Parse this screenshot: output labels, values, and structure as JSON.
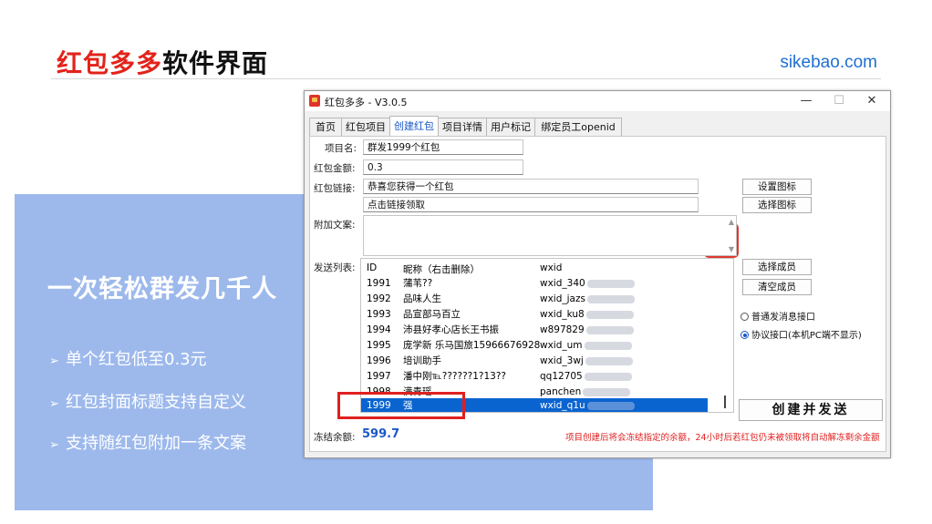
{
  "slide": {
    "title_red": "红包多多",
    "title_black": "软件界面",
    "brand": "sikebao.com",
    "heading": "一次轻松群发几千人",
    "bullets": [
      "单个红包低至0.3元",
      "红包封面标题支持自定义",
      "支持随红包附加一条文案"
    ],
    "bullet_icon": "arrow-right-icon"
  },
  "window": {
    "title": "红包多多 - V3.0.5",
    "minimize": "—",
    "maximize": "☐",
    "close": "✕",
    "tabs": [
      "首页",
      "红包项目",
      "创建红包",
      "项目详情",
      "用户标记",
      "绑定员工openid"
    ],
    "active_tab": "创建红包"
  },
  "form": {
    "project_name_label": "项目名:",
    "project_name_value": "群发1999个红包",
    "amount_label": "红包金额:",
    "amount_value": "0.3",
    "link_label": "红包链接:",
    "link_title_value": "恭喜您获得一个红包",
    "link_subtitle_value": "点击链接领取",
    "set_icon_button": "设置图标",
    "choose_icon_button": "选择图标",
    "extra_text_label": "附加文案:",
    "send_list_label": "发送列表:",
    "frozen_label": "冻结余额:",
    "frozen_value": "599.7",
    "notice": "项目创建后将会冻结指定的余额，24小时后若红包仍未被领取将自动解冻剩余金额"
  },
  "list": {
    "headers": [
      "ID",
      "昵称（右击删除）",
      "wxid"
    ],
    "rows": [
      {
        "id": "1991",
        "nick": "蒲苇??",
        "wxid": "wxid_340"
      },
      {
        "id": "1992",
        "nick": "品味人生",
        "wxid": "wxid_jazs"
      },
      {
        "id": "1993",
        "nick": "品宣部马百立",
        "wxid": "wxid_ku8"
      },
      {
        "id": "1994",
        "nick": "沛县好孝心店长王书振",
        "wxid": "w897829"
      },
      {
        "id": "1995",
        "nick": "庞学新  乐马国旅15966676928",
        "wxid": "wxid_um"
      },
      {
        "id": "1996",
        "nick": "培训助手",
        "wxid": "wxid_3wj"
      },
      {
        "id": "1997",
        "nick": "潘中刚℡??????1?13??",
        "wxid": "qq12705"
      },
      {
        "id": "1998",
        "nick": "满青瑶",
        "wxid": "panchen"
      },
      {
        "id": "1999",
        "nick": "强",
        "wxid": "wxid_q1u",
        "selected": true
      }
    ]
  },
  "side": {
    "select_members_button": "选择成员",
    "clear_members_button": "清空成员",
    "radio_normal": "普通发消息接口",
    "radio_protocol": "协议接口(本机PC端不显示)",
    "selected_radio": "radio_protocol",
    "create_button": "创建并发送"
  },
  "colors": {
    "accent_red": "#e2231a",
    "brand_blue": "#1f6fd1",
    "panel_blue": "#9db9ec",
    "selection_blue": "#0a64d0",
    "frozen_blue": "#1a58c7",
    "notice_red": "#e02020"
  }
}
